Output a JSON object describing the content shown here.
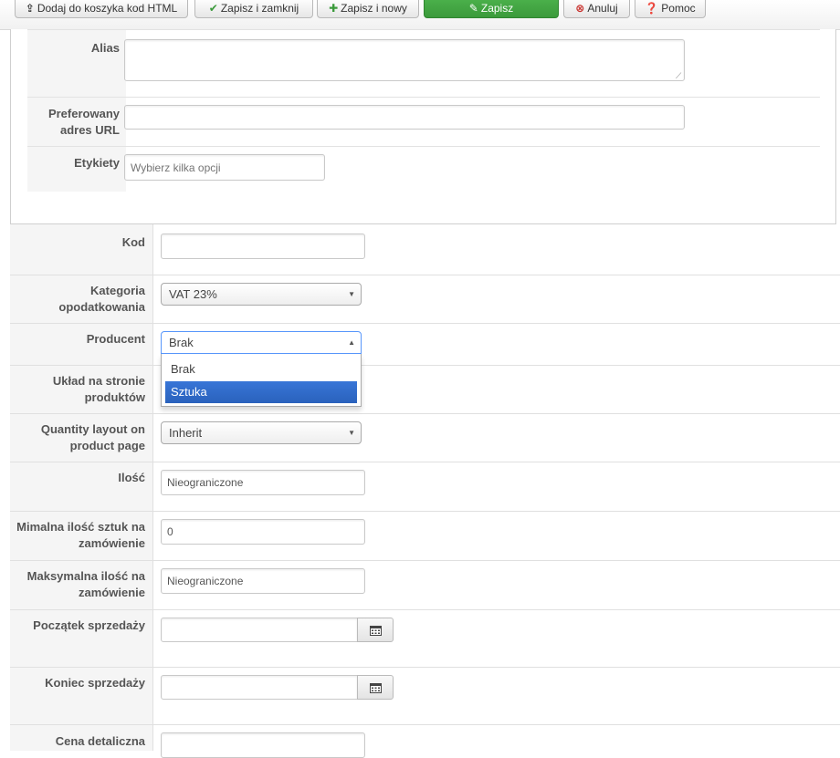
{
  "toolbar": {
    "buttons": [
      {
        "icon": "upload-icon",
        "label": "Dodaj do koszyka kod HTML"
      },
      {
        "icon": "check-icon",
        "label": "Zapisz i zamknij"
      },
      {
        "icon": "plus-icon",
        "label": "Zapisz i nowy"
      },
      {
        "icon": "edit-icon",
        "label": "Zapisz"
      },
      {
        "icon": "cancel-icon",
        "label": "Anuluj"
      },
      {
        "icon": "help-icon",
        "label": "Pomoc"
      }
    ],
    "accent_color": "#46a546"
  },
  "upper": {
    "alias_label": "Alias",
    "alias_value": "",
    "url_label": "Preferowany adres URL",
    "url_value": "",
    "tags_label": "Etykiety",
    "tags_placeholder": "Wybierz kilka opcji"
  },
  "form": {
    "code_label": "Kod",
    "code_value": "",
    "tax_label": "Kategoria opodatkowania",
    "tax_value": "VAT 23%",
    "producer_label": "Producent",
    "producer_value": "Brak",
    "producer_options": [
      "Brak",
      "Sztuka"
    ],
    "producer_highlighted": "Sztuka",
    "layout_label": "Układ na stronie produktów",
    "qty_layout_label": "Quantity layout on product page",
    "qty_layout_value": "Inherit",
    "quantity_label": "Ilość",
    "quantity_value": "Nieograniczone",
    "min_qty_label": "Mimalna ilość sztuk na zamówienie",
    "min_qty_value": "0",
    "max_qty_label": "Maksymalna ilość na zamówienie",
    "max_qty_value": "Nieograniczone",
    "sale_start_label": "Początek sprzedaży",
    "sale_start_value": "",
    "sale_end_label": "Koniec sprzedaży",
    "sale_end_value": "",
    "retail_price_label": "Cena detaliczna",
    "retail_price_value": ""
  },
  "colors": {
    "highlight": "#3875d7",
    "focus_border": "#5897fb"
  }
}
